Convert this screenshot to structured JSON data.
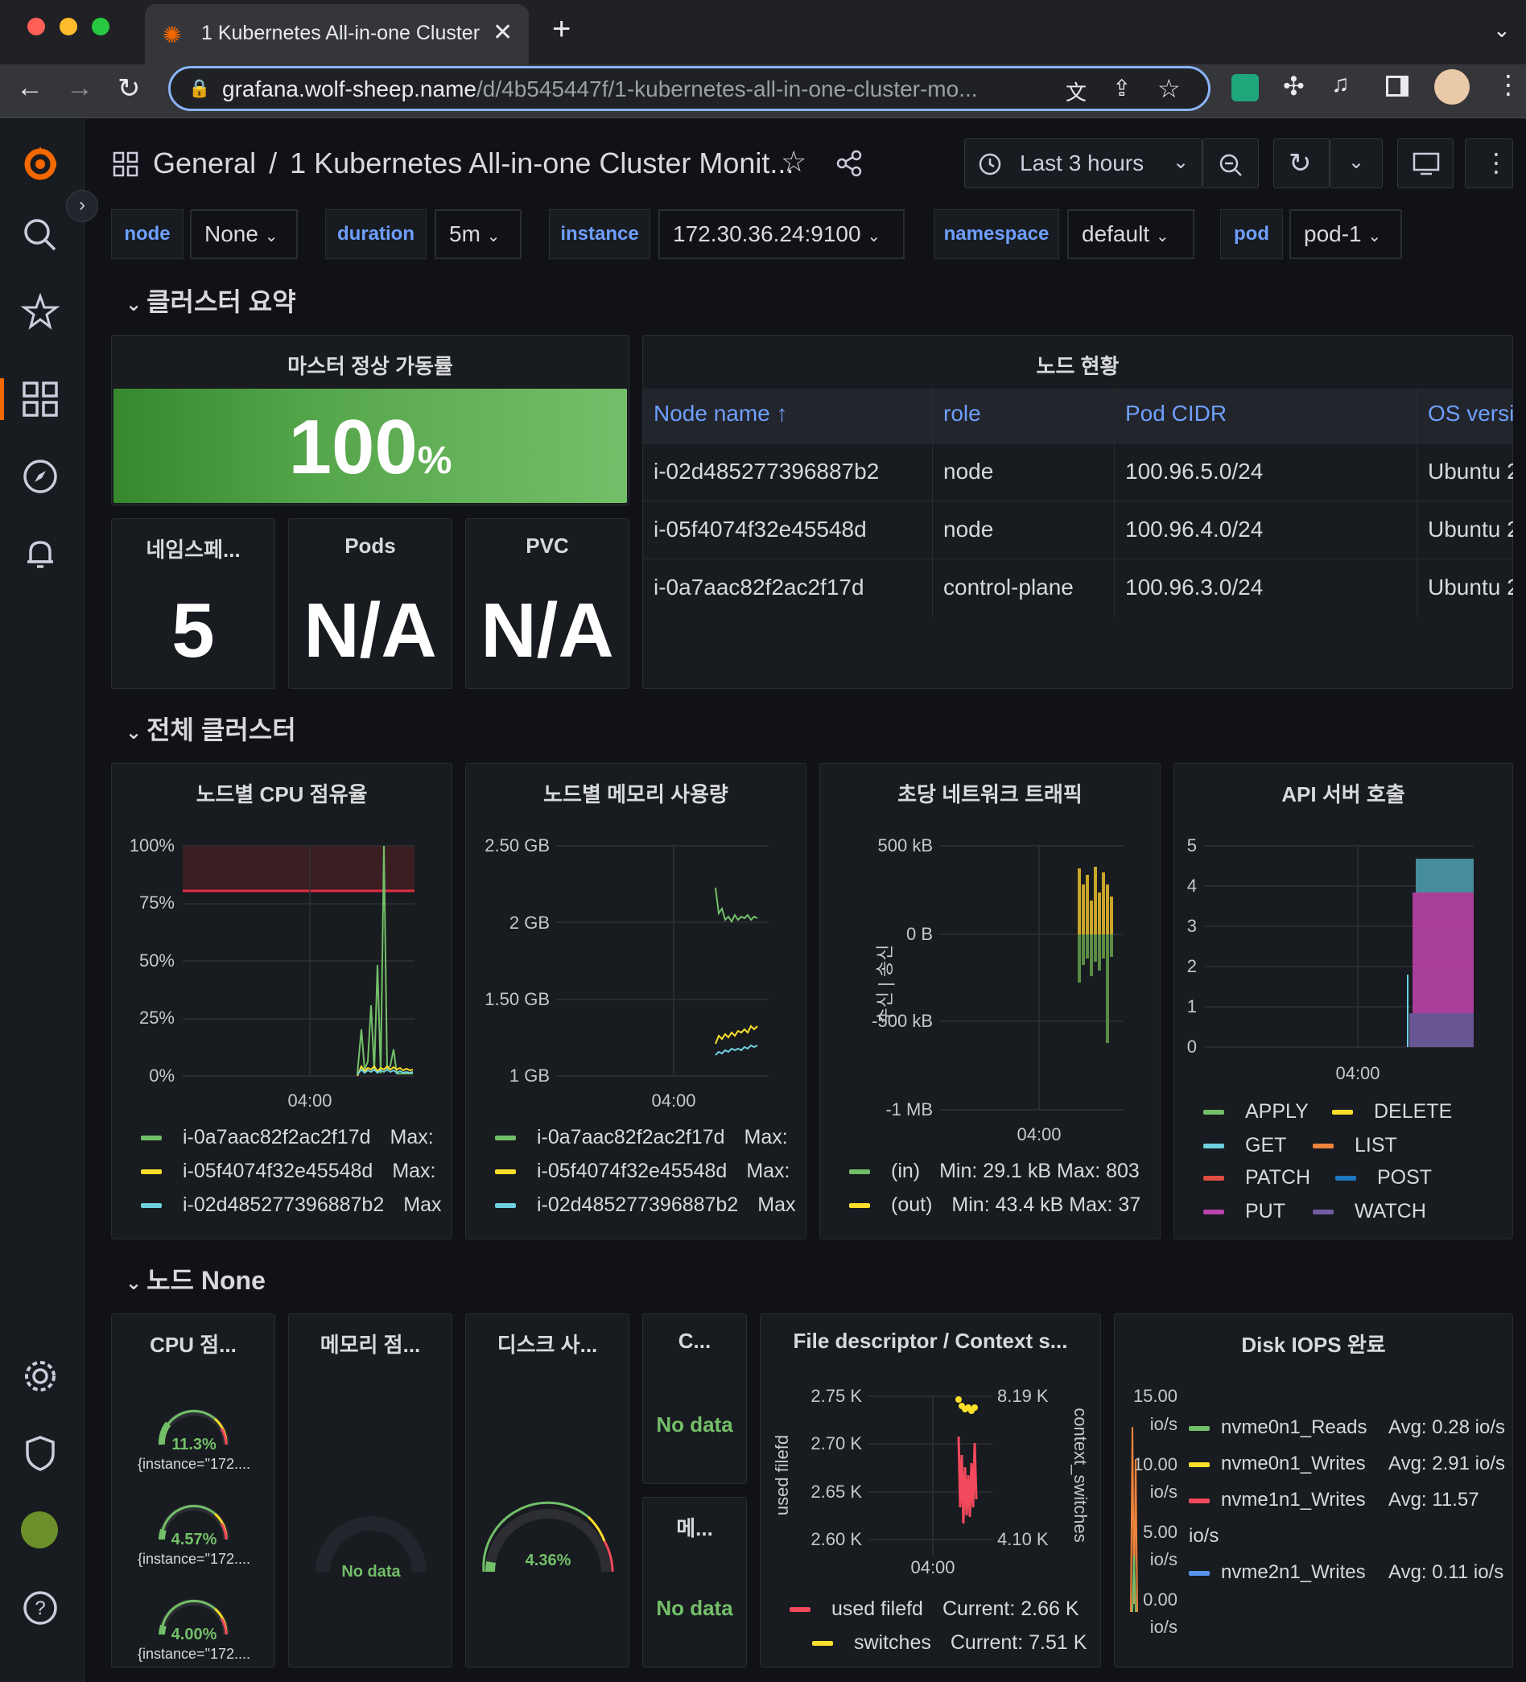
{
  "browser": {
    "tab_title": "1 Kubernetes All-in-one Cluster",
    "url_host": "grafana.wolf-sheep.name",
    "url_path": "/d/4b545447f/1-kubernetes-all-in-one-cluster-mo..."
  },
  "header": {
    "breadcrumb_root": "General",
    "breadcrumb_sep": "/",
    "title": "1 Kubernetes All-in-one Cluster Monit...",
    "time_range": "Last 3 hours"
  },
  "variables": [
    {
      "label": "node",
      "value": "None"
    },
    {
      "label": "duration",
      "value": "5m"
    },
    {
      "label": "instance",
      "value": "172.30.36.24:9100"
    },
    {
      "label": "namespace",
      "value": "default"
    },
    {
      "label": "pod",
      "value": "pod-1"
    }
  ],
  "rows": {
    "summary": "클러스터 요약",
    "cluster": "전체 클러스터",
    "node": "노드 None"
  },
  "stats": {
    "master_title": "마스터 정상 가동률",
    "master_value": "100",
    "master_unit": "%",
    "ns_title": "네임스페...",
    "ns_value": "5",
    "pods_title": "Pods",
    "pods_value": "N/A",
    "pvc_title": "PVC",
    "pvc_value": "N/A"
  },
  "node_table": {
    "title": "노드 현황",
    "columns": [
      "Node name ↑",
      "role",
      "Pod CIDR",
      "OS versi"
    ],
    "rows": [
      [
        "i-02d485277396887b2",
        "node",
        "100.96.5.0/24",
        "Ubuntu 2"
      ],
      [
        "i-05f4074f32e45548d",
        "node",
        "100.96.4.0/24",
        "Ubuntu 2"
      ],
      [
        "i-0a7aac82f2ac2f17d",
        "control-plane",
        "100.96.3.0/24",
        "Ubuntu 2"
      ]
    ]
  },
  "cpu_panel": {
    "title": "노드별 CPU 점유율",
    "yticks": [
      "100%",
      "75%",
      "50%",
      "25%",
      "0%"
    ],
    "xtick": "04:00",
    "legend": [
      {
        "name": "i-0a7aac82f2ac2f17d",
        "stat": "Max:",
        "color": "#73bf69"
      },
      {
        "name": "i-05f4074f32e45548d",
        "stat": "Max:",
        "color": "#fade2a"
      },
      {
        "name": "i-02d485277396887b2",
        "stat": "Max",
        "color": "#5794f2"
      }
    ]
  },
  "mem_panel": {
    "title": "노드별 메모리 사용량",
    "yticks": [
      "2.50 GB",
      "2 GB",
      "1.50 GB",
      "1 GB"
    ],
    "xtick": "04:00",
    "legend": [
      {
        "name": "i-0a7aac82f2ac2f17d",
        "stat": "Max:",
        "color": "#73bf69"
      },
      {
        "name": "i-05f4074f32e45548d",
        "stat": "Max:",
        "color": "#fade2a"
      },
      {
        "name": "i-02d485277396887b2",
        "stat": "Max",
        "color": "#5794f2"
      }
    ]
  },
  "net_panel": {
    "title": "초당 네트워크 트래픽",
    "yticks": [
      "500 kB",
      "0 B",
      "-500 kB",
      "-1 MB"
    ],
    "ylabel": "수신 | 송신",
    "xtick": "04:00",
    "legend": [
      {
        "name": "(in)",
        "stat": "Min: 29.1 kB  Max: 803",
        "color": "#73bf69"
      },
      {
        "name": "(out)",
        "stat": "Min: 43.4 kB  Max: 37",
        "color": "#fade2a"
      }
    ]
  },
  "api_panel": {
    "title": "API 서버 호출",
    "yticks": [
      "5",
      "4",
      "3",
      "2",
      "1",
      "0"
    ],
    "xtick": "04:00",
    "legend": [
      {
        "name": "APPLY",
        "color": "#73bf69"
      },
      {
        "name": "DELETE",
        "color": "#fade2a"
      },
      {
        "name": "GET",
        "color": "#6ed0e0"
      },
      {
        "name": "LIST",
        "color": "#ef843c"
      },
      {
        "name": "PATCH",
        "color": "#e24d42"
      },
      {
        "name": "POST",
        "color": "#1f78c1"
      },
      {
        "name": "PUT",
        "color": "#ba43a9"
      },
      {
        "name": "WATCH",
        "color": "#705da0"
      }
    ]
  },
  "node_row": {
    "cpu_title": "CPU 점...",
    "cpu_gauges": [
      {
        "value": "11.3%",
        "label": "{instance=\"172...."
      },
      {
        "value": "4.57%",
        "label": "{instance=\"172...."
      },
      {
        "value": "4.00%",
        "label": "{instance=\"172...."
      }
    ],
    "mem_title": "메모리 점...",
    "mem_value": "No data",
    "disk_title": "디스크 사...",
    "disk_value": "4.36%",
    "c_title": "C...",
    "c_value": "No data",
    "m_title": "메...",
    "m_value": "No data",
    "fd_title": "File descriptor / Context s...",
    "fd_yleft": [
      "2.75 K",
      "2.70 K",
      "2.65 K",
      "2.60 K"
    ],
    "fd_yright": [
      "8.19 K",
      "4.10 K"
    ],
    "fd_ylabel_left": "used filefd",
    "fd_ylabel_right": "context_switches",
    "fd_xtick": "04:00",
    "fd_legend": [
      {
        "name": "used filefd",
        "stat": "Current: 2.66 K",
        "color": "#f2495c"
      },
      {
        "name": "switches",
        "stat": "Current: 7.51 K",
        "color": "#fade2a"
      }
    ],
    "iops_title": "Disk IOPS 완료",
    "iops_yticks": [
      "15.00",
      "io/s",
      "10.00",
      "io/s",
      "5.00",
      "io/s",
      "0.00",
      "io/s"
    ],
    "iops_legend": [
      {
        "name": "nvme0n1_Reads",
        "stat": "Avg: 0.28 io/s",
        "color": "#73bf69"
      },
      {
        "name": "nvme0n1_Writes",
        "stat": "Avg: 2.91 io/s",
        "color": "#fade2a"
      },
      {
        "name": "nvme1n1_Writes",
        "stat": "Avg: 11.57 io/s",
        "color": "#f2495c"
      },
      {
        "name": "nvme2n1_Writes",
        "stat": "Avg: 0.11 io/s",
        "color": "#5794f2"
      }
    ]
  }
}
